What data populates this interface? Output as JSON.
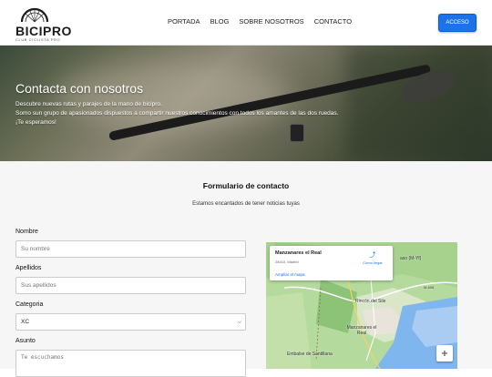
{
  "header": {
    "logo_text": "BICIPRO",
    "logo_subtext": "CLUB CICLISTA PRO",
    "nav": [
      "PORTADA",
      "BLOG",
      "SOBRE NOSOTROS",
      "CONTACTO"
    ],
    "login_label": "ACCESO",
    "accent": "#1a73e8"
  },
  "hero": {
    "title": "Contacta con nosotros",
    "line1": "Descubre nuevas rutas y parajes de la mano de bicipro.",
    "line2": "Somo sun grupo de apasionados dispuestos a compartir nuestros conocimientos con todos los amantes de las dos ruedas.",
    "line3": "¡Te esperamos!"
  },
  "form": {
    "title": "Formulario de contacto",
    "subtitle": "Estamos encantados de tener noticias tuyas",
    "name_label": "Nombre",
    "name_placeholder": "Su nombre",
    "surname_label": "Apellidos",
    "surname_placeholder": "Sus apellidos",
    "category_label": "Categoria",
    "category_value": "XC",
    "subject_label": "Asunto",
    "subject_placeholder": "Te escuchamos"
  },
  "map": {
    "place": "Manzanares el Real",
    "address": "28410, Madrid",
    "directions_label": "Cómo llegar",
    "directions_icon": "directions-icon",
    "enlarge_label": "Ampliar el mapa",
    "labels": [
      "aso (M-Yf)",
      "M-608",
      "Rincón del Sile",
      "Manzanares el Real",
      "Embalse de Santillana"
    ],
    "zoom_in": "+"
  }
}
